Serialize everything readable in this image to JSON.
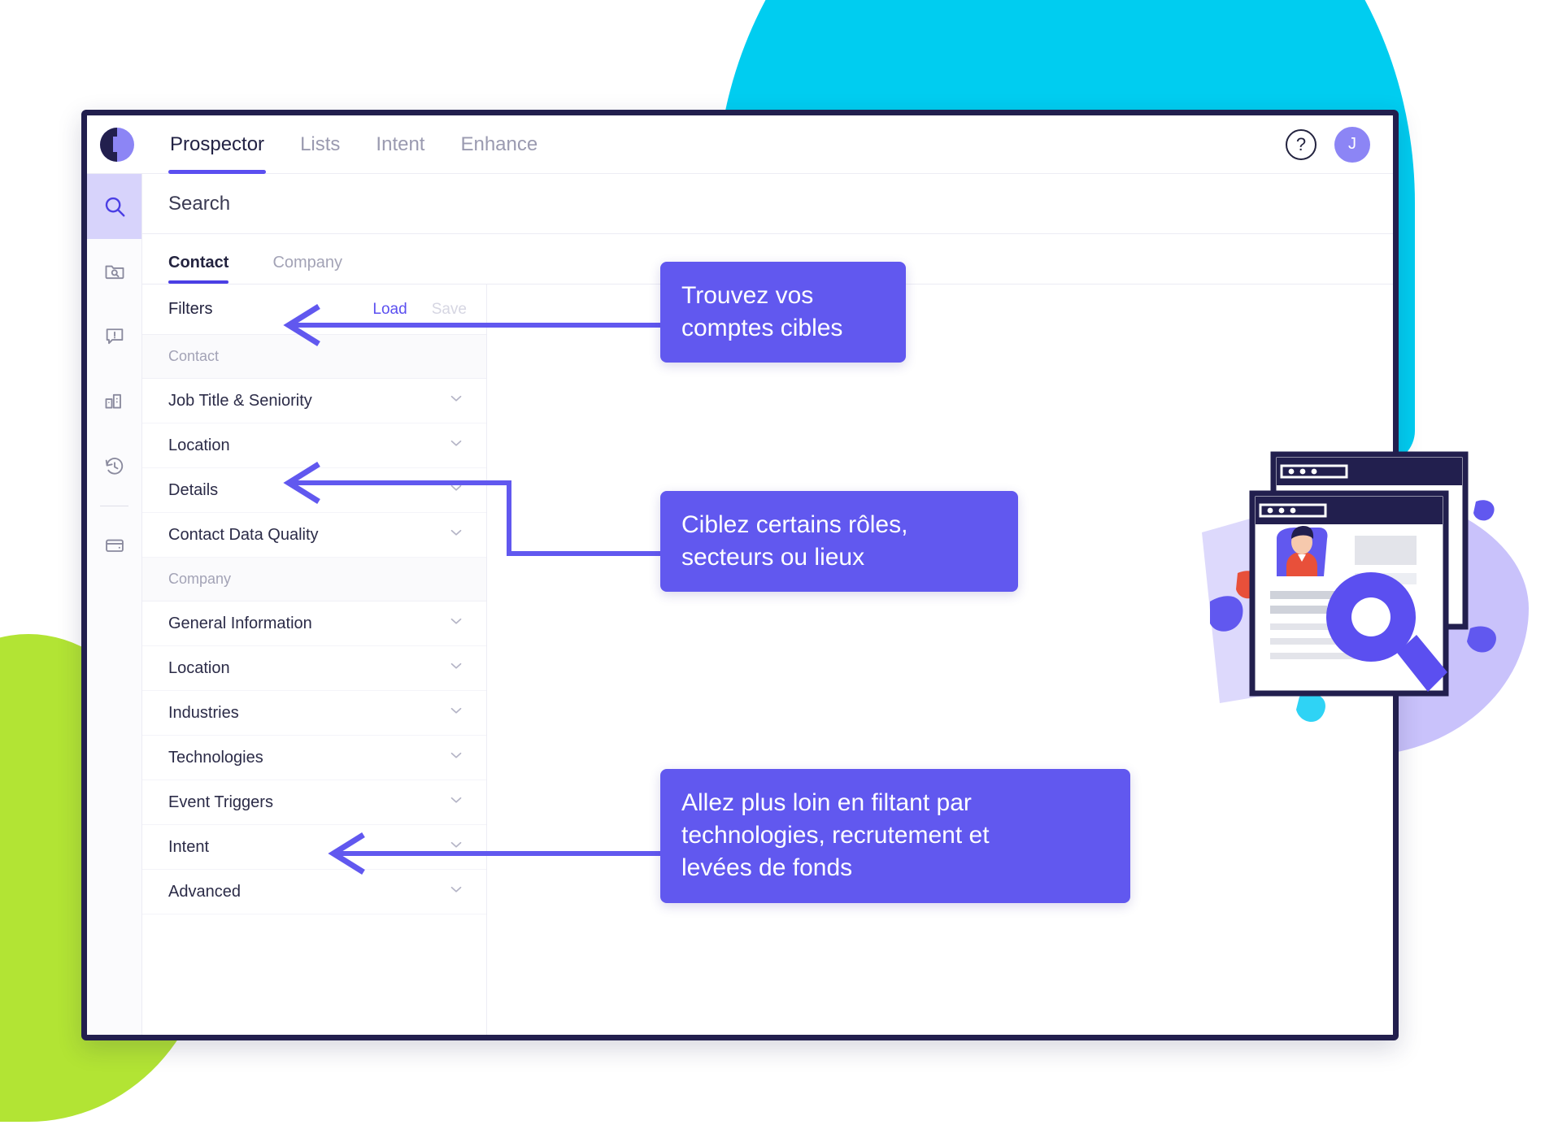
{
  "brand": {
    "logo_name": "logo-mark",
    "accent": "#5b4ff0",
    "callout_bg": "#6158ef",
    "cyan": "#00cdf0",
    "green": "#b2e434",
    "navy": "#221f4e"
  },
  "topbar": {
    "tabs": [
      {
        "label": "Prospector",
        "active": true
      },
      {
        "label": "Lists",
        "active": false
      },
      {
        "label": "Intent",
        "active": false
      },
      {
        "label": "Enhance",
        "active": false
      }
    ],
    "help_label": "?",
    "avatar_initial": "J"
  },
  "rail": {
    "items": [
      {
        "name": "search-icon",
        "active": true
      },
      {
        "name": "folder-search-icon",
        "active": false
      },
      {
        "name": "alert-message-icon",
        "active": false
      },
      {
        "name": "buildings-icon",
        "active": false
      },
      {
        "name": "history-clock-icon",
        "active": false
      },
      {
        "name": "wallet-icon",
        "active": false
      }
    ]
  },
  "search": {
    "label": "Search"
  },
  "subtabs": [
    {
      "label": "Contact",
      "active": true
    },
    {
      "label": "Company",
      "active": false
    }
  ],
  "filters": {
    "title": "Filters",
    "load_label": "Load",
    "save_label": "Save",
    "groups": [
      {
        "label": "Contact",
        "rows": [
          {
            "label": "Job Title & Seniority"
          },
          {
            "label": "Location"
          },
          {
            "label": "Details"
          },
          {
            "label": "Contact Data Quality"
          }
        ]
      },
      {
        "label": "Company",
        "rows": [
          {
            "label": "General Information"
          },
          {
            "label": "Location"
          },
          {
            "label": "Industries"
          },
          {
            "label": "Technologies"
          },
          {
            "label": "Event Triggers"
          },
          {
            "label": "Intent"
          },
          {
            "label": "Advanced"
          }
        ]
      }
    ]
  },
  "callouts": [
    {
      "text": "Trouvez vos\ncomptes cibles"
    },
    {
      "text": "Ciblez certains rôles,\nsecteurs ou lieux"
    },
    {
      "text": "Allez plus loin en filtant par\ntechnologies, recrutement et\nlevées de fonds"
    }
  ]
}
